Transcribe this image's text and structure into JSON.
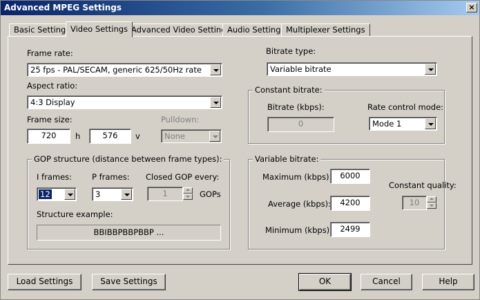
{
  "window": {
    "title": "Advanced MPEG Settings",
    "close_glyph": "×"
  },
  "tabs": [
    {
      "label": "Basic Settings"
    },
    {
      "label": "Video Settings"
    },
    {
      "label": "Advanced Video Settings"
    },
    {
      "label": "Audio Settings"
    },
    {
      "label": "Multiplexer Settings"
    }
  ],
  "active_tab": "Video Settings",
  "frame_rate": {
    "label": "Frame rate:",
    "value": "25 fps - PAL/SECAM, generic 625/50Hz rate"
  },
  "aspect_ratio": {
    "label": "Aspect ratio:",
    "value": "4:3 Display"
  },
  "frame_size": {
    "label": "Frame size:",
    "h_value": "720",
    "h_unit": "h",
    "v_value": "576",
    "v_unit": "v"
  },
  "pulldown": {
    "label": "Pulldown:",
    "value": "None"
  },
  "gop": {
    "title": "GOP structure (distance between frame types):",
    "i_frames_label": "I frames:",
    "i_frames_value": "12",
    "p_frames_label": "P frames:",
    "p_frames_value": "3",
    "closed_gop_label": "Closed GOP every:",
    "closed_gop_value": "1",
    "closed_gop_unit": "GOPs",
    "structure_label": "Structure example:",
    "structure_value": "BBIBBPBBPBBP ..."
  },
  "bitrate_type": {
    "label": "Bitrate type:",
    "value": "Variable bitrate"
  },
  "constant_bitrate": {
    "title": "Constant bitrate:",
    "bitrate_label": "Bitrate (kbps):",
    "bitrate_value": "0",
    "rate_control_label": "Rate control mode:",
    "rate_control_value": "Mode 1"
  },
  "variable_bitrate": {
    "title": "Variable bitrate:",
    "maximum_label": "Maximum (kbps):",
    "maximum_value": "6000",
    "average_label": "Average (kbps):",
    "average_value": "4200",
    "minimum_label": "Minimum (kbps):",
    "minimum_value": "2499",
    "quality_label": "Constant quality:",
    "quality_value": "10"
  },
  "buttons": {
    "load": "Load Settings",
    "save": "Save Settings",
    "ok": "OK",
    "cancel": "Cancel",
    "help": "Help"
  },
  "colors": {
    "titlebar_start": "#0a246a",
    "titlebar_end": "#a6caf0",
    "face": "#d4d0c8",
    "selection": "#0a246a"
  }
}
